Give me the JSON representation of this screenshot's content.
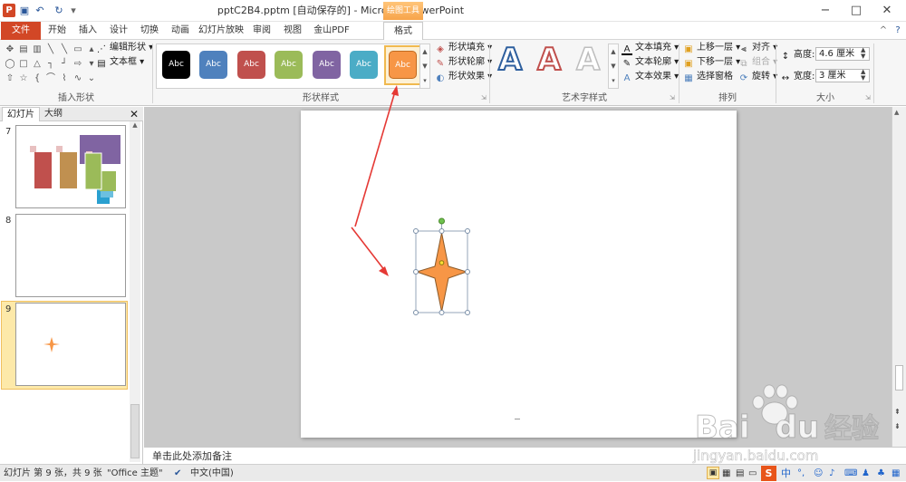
{
  "window": {
    "title": "pptC2B4.pptm [自动保存的] - Microsoft PowerPoint",
    "context_tab_header": "绘图工具",
    "controls": [
      "−",
      "□",
      "✕"
    ]
  },
  "tabs": [
    "文件",
    "开始",
    "插入",
    "设计",
    "切换",
    "动画",
    "幻灯片放映",
    "审阅",
    "视图",
    "金山PDF",
    "格式"
  ],
  "ribbon": {
    "insert_shapes": {
      "label": "插入形状",
      "edit_shape": "编辑形状",
      "text_box": "文本框"
    },
    "shape_styles": {
      "label": "形状样式",
      "swatch_text": "Abc",
      "swatch_colors": [
        "#000000",
        "#4f81bd",
        "#c0504d",
        "#9bbb59",
        "#8064a2",
        "#4bacc6",
        "#f79646"
      ],
      "fill": "形状填充",
      "outline": "形状轮廓",
      "effects": "形状效果"
    },
    "wordart": {
      "label": "艺术字样式",
      "letter": "A",
      "text_fill": "文本填充",
      "text_outline": "文本轮廓",
      "text_effects": "文本效果"
    },
    "arrange": {
      "label": "排列",
      "bring_forward": "上移一层",
      "send_backward": "下移一层",
      "selection_pane": "选择窗格",
      "align": "对齐",
      "group": "组合",
      "rotate": "旋转"
    },
    "size": {
      "label": "大小",
      "height_label": "高度:",
      "height_value": "4.6 厘米",
      "width_label": "宽度:",
      "width_value": "3 厘米"
    }
  },
  "panel": {
    "tab_slides": "幻灯片",
    "tab_outline": "大纲",
    "close": "✕",
    "slide_numbers": [
      "7",
      "8",
      "9"
    ]
  },
  "notes_placeholder": "单击此处添加备注",
  "status": {
    "slide_info": "幻灯片 第 9 张，共 9 张",
    "theme": "\"Office 主题\"",
    "language": "中文(中国)"
  },
  "watermark": {
    "brand": "Bai",
    "brand_tail": "du",
    "cn": "经验",
    "url": "jingyan.baidu.com"
  },
  "colors": {
    "accent_file_tab": "#d24726",
    "star_fill": "#f79646",
    "star_stroke": "#8a5a2a",
    "arrow": "#e53935",
    "thumb_selected": "#fde9a9"
  }
}
